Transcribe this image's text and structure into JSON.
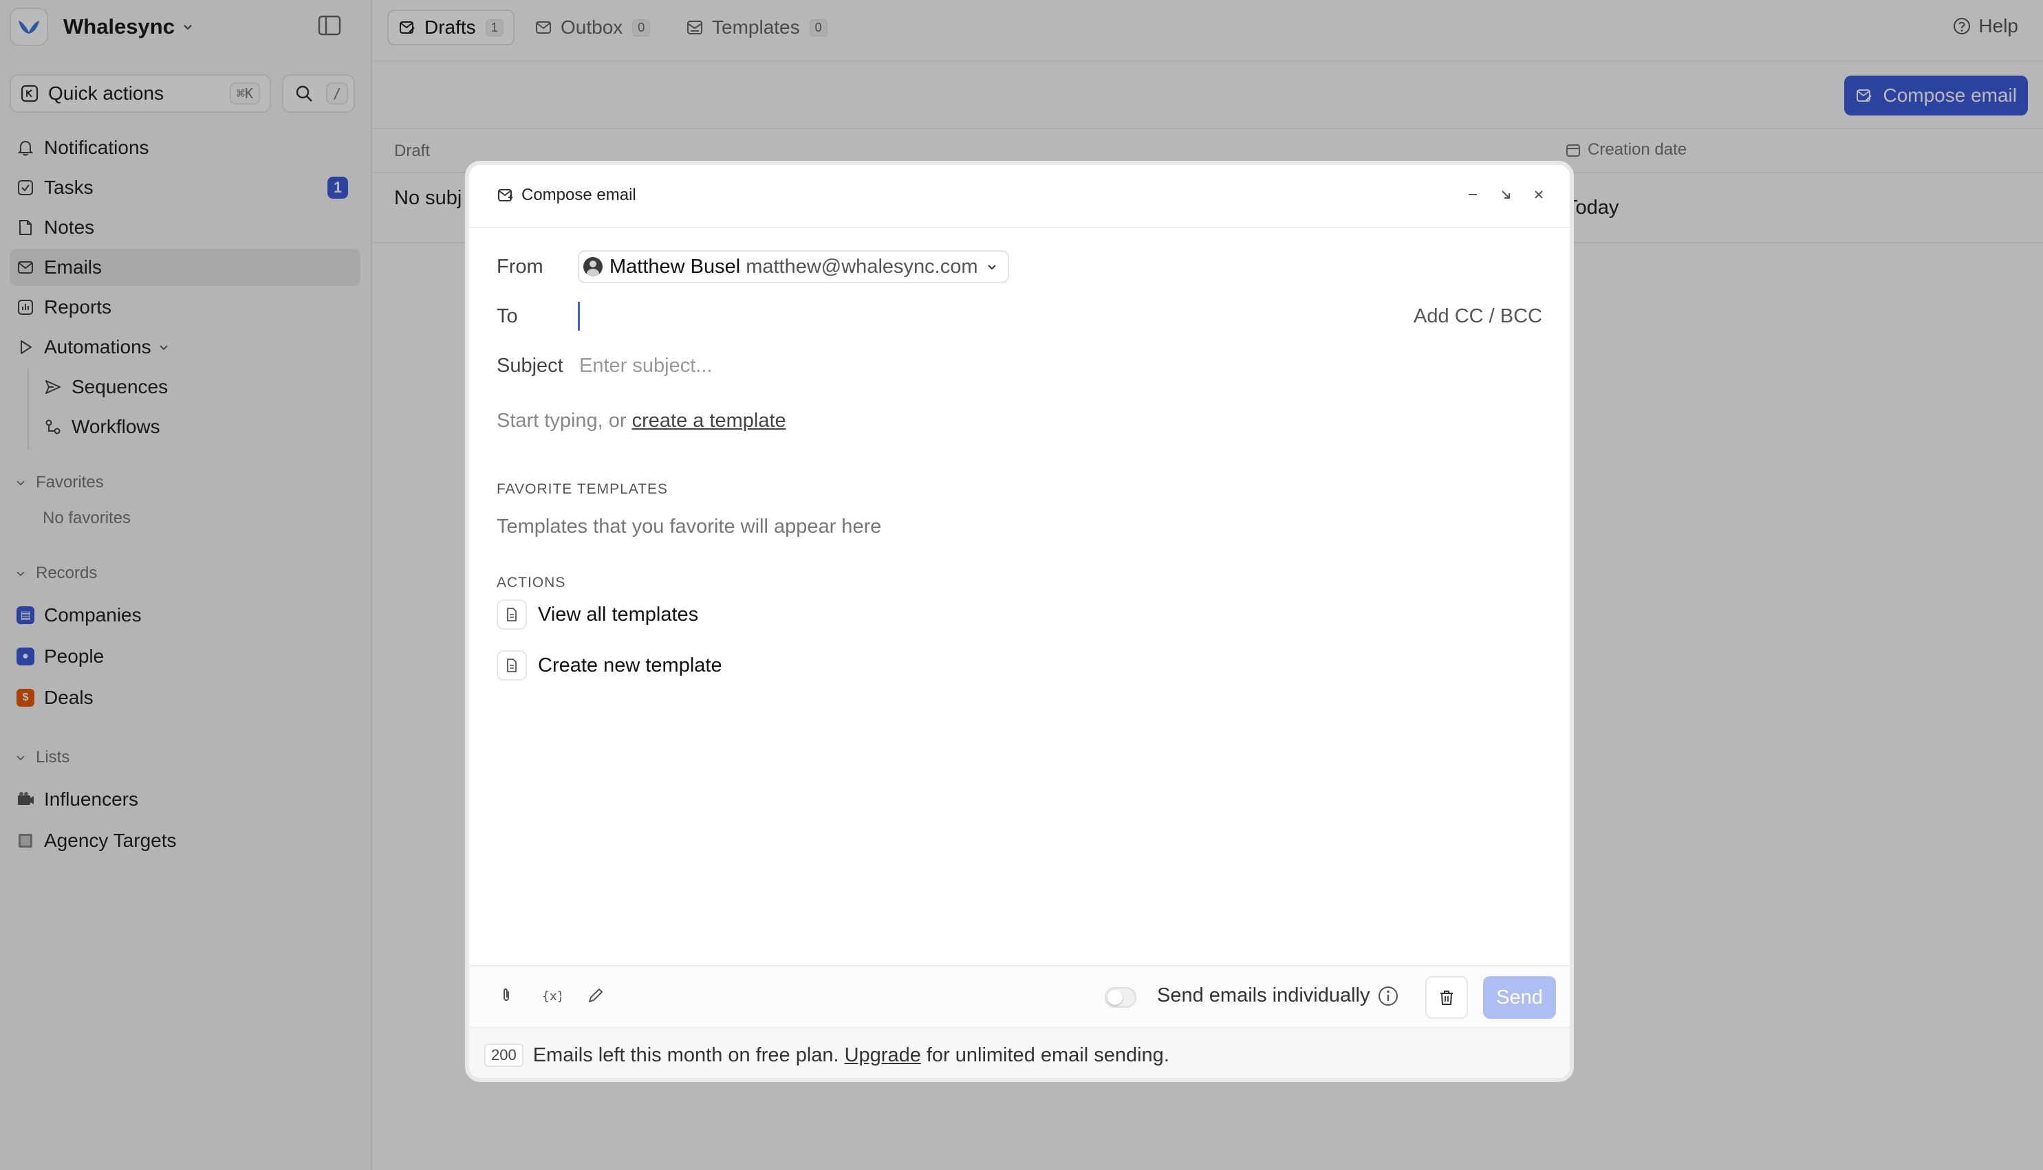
{
  "sidebar": {
    "workspace": "Whalesync",
    "quick_actions": {
      "label": "Quick actions",
      "shortcut": "⌘K"
    },
    "search": {
      "shortcut": "/"
    },
    "nav": [
      {
        "label": "Notifications",
        "icon": "bell-icon"
      },
      {
        "label": "Tasks",
        "icon": "checkbox-icon",
        "badge": "1"
      },
      {
        "label": "Notes",
        "icon": "note-icon"
      },
      {
        "label": "Emails",
        "icon": "mail-icon",
        "active": true
      },
      {
        "label": "Reports",
        "icon": "report-icon"
      },
      {
        "label": "Automations",
        "icon": "play-icon"
      }
    ],
    "automations_children": [
      {
        "label": "Sequences",
        "icon": "send-icon"
      },
      {
        "label": "Workflows",
        "icon": "workflow-icon"
      }
    ],
    "favorites": {
      "title": "Favorites",
      "empty": "No favorites"
    },
    "records": {
      "title": "Records",
      "items": [
        {
          "label": "Companies",
          "color": "#3b5bdb"
        },
        {
          "label": "People",
          "color": "#3b5bdb"
        },
        {
          "label": "Deals",
          "color": "#e8590c"
        }
      ]
    },
    "lists": {
      "title": "Lists",
      "items": [
        {
          "label": "Influencers",
          "icon": "camera-icon"
        },
        {
          "label": "Agency Targets",
          "icon": "table-icon"
        }
      ]
    }
  },
  "header": {
    "tabs": [
      {
        "label": "Drafts",
        "count": "1",
        "active": true
      },
      {
        "label": "Outbox",
        "count": "0"
      },
      {
        "label": "Templates",
        "count": "0"
      }
    ],
    "help": "Help",
    "compose_button": "Compose email"
  },
  "table": {
    "columns": [
      "Draft",
      "Creation date"
    ],
    "rows": [
      {
        "draft": "No subj",
        "created": "Today"
      }
    ]
  },
  "modal": {
    "title": "Compose email",
    "from_label": "From",
    "from_name": "Matthew Busel",
    "from_email": "matthew@whalesync.com",
    "to_label": "To",
    "to_value": "",
    "add_cc": "Add CC / BCC",
    "subject_label": "Subject",
    "subject_placeholder": "Enter subject...",
    "body_hint": "Start typing, or",
    "body_link": "create a template",
    "favorite_templates_title": "FAVORITE TEMPLATES",
    "favorite_templates_empty": "Templates that you favorite will appear here",
    "actions_title": "ACTIONS",
    "actions": [
      "View all templates",
      "Create new template"
    ],
    "send_individually": "Send emails individually",
    "send": "Send",
    "note": {
      "count": "200",
      "text_before": "Emails left this month on free plan.",
      "link": "Upgrade",
      "text_after": "for unlimited email sending."
    }
  },
  "colors": {
    "accent": "#3b5bdb",
    "send_disabled": "#aebdf2",
    "deals": "#e8590c"
  }
}
